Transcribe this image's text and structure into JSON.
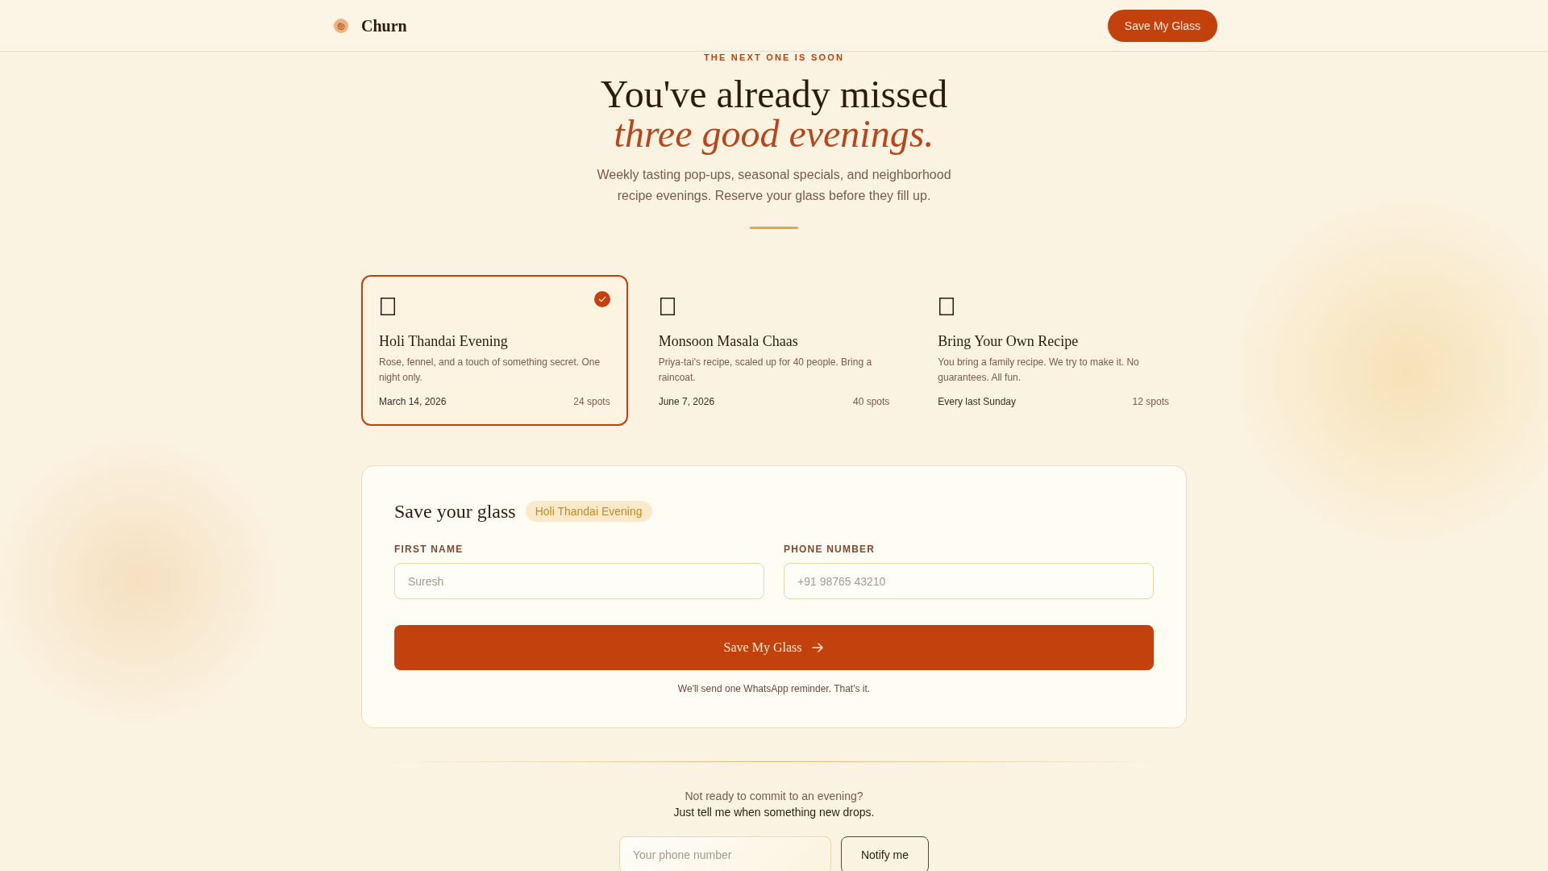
{
  "header": {
    "brand": "Churn",
    "button": "Save My Glass"
  },
  "hero": {
    "eyebrow": "THE NEXT ONE IS SOON",
    "title": "You've already missed *three good evenings.*",
    "lede": "Weekly tasting pop-ups, seasonal specials, and neighborhood recipe evenings. Reserve your glass before they fill up."
  },
  "events": [
    {
      "title": "Holi Thandai Evening",
      "description": "Rose, fennel, and a touch of something secret. One night only.",
      "date": "March 14, 2026",
      "spots": "24 spots",
      "selected": true
    },
    {
      "title": "Monsoon Masala Chaas",
      "description": "Priya-tai's recipe, scaled up for 40 people. Bring a raincoat.",
      "date": "June 7, 2026",
      "spots": "40 spots",
      "selected": false
    },
    {
      "title": "Bring Your Own Recipe",
      "description": "You bring a family recipe. We try to make it. No guarantees. All fun.",
      "date": "Every last Sunday",
      "spots": "12 spots",
      "selected": false
    }
  ],
  "reservation": {
    "title": "Save your glass",
    "badge": "Holi Thandai Evening",
    "fields": [
      {
        "label": "FIRST NAME",
        "placeholder": "Suresh"
      },
      {
        "label": "PHONE NUMBER",
        "placeholder": "+91 98765 43210"
      }
    ],
    "button": "Save My Glass",
    "note": "We'll send one WhatsApp reminder. That's it."
  },
  "notify": {
    "question": "Not ready to commit to an evening?",
    "prompt": "Just tell me when something new drops.",
    "field": {
      "placeholder": "Your phone number"
    },
    "button": "Notify me"
  }
}
